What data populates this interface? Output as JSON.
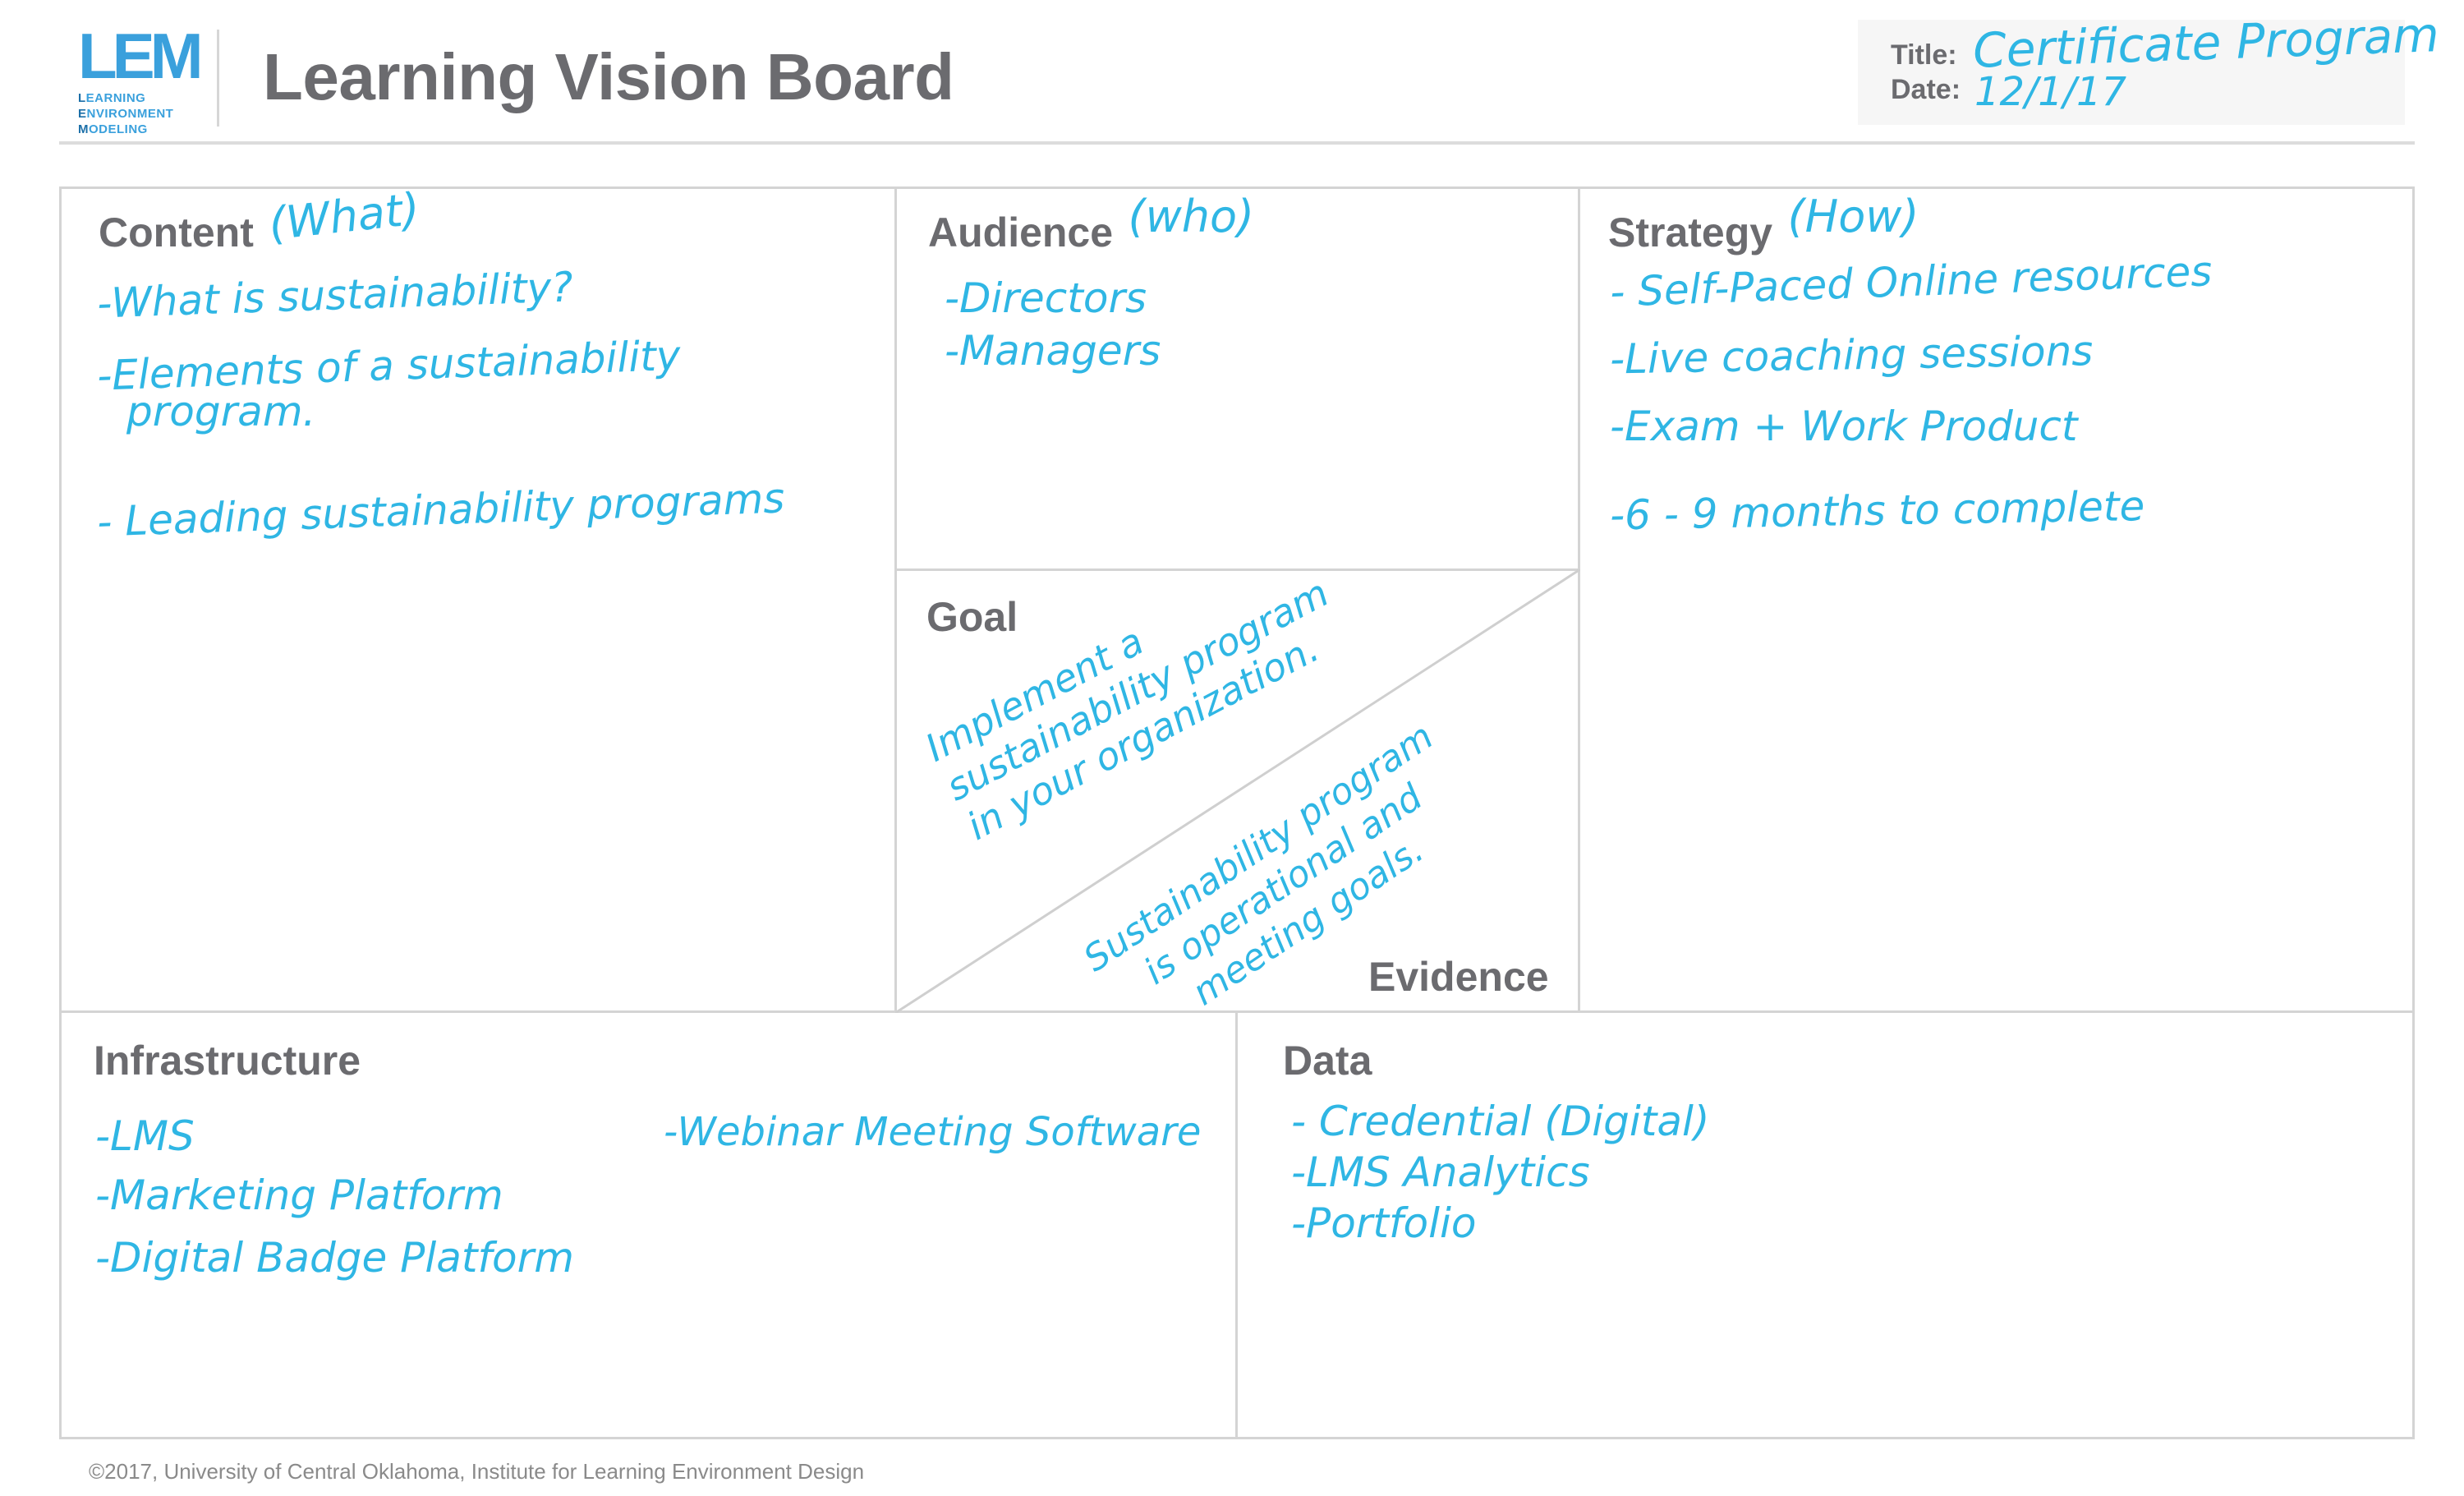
{
  "logo": {
    "mark": "LEM",
    "lines": [
      {
        "initial": "L",
        "rest": "EARNING"
      },
      {
        "initial": "E",
        "rest": "NVIRONMENT"
      },
      {
        "initial": "M",
        "rest": "ODELING"
      }
    ]
  },
  "header": {
    "title": "Learning Vision Board",
    "title_label": "Title:",
    "title_value": "Certificate Program",
    "date_label": "Date:",
    "date_value": "12/1/17"
  },
  "colors": {
    "handwriting": "#2fb6e4",
    "brand": "#3aa0dc",
    "heading": "#6b6b6f",
    "border": "#d4d4d4"
  },
  "panels": {
    "content": {
      "title": "Content",
      "aside": "(What)",
      "items": [
        "-What is sustainability?",
        "-Elements of a sustainability",
        "program.",
        "- Leading sustainability programs"
      ]
    },
    "audience": {
      "title": "Audience",
      "aside": "(who)",
      "items": [
        "-Directors",
        "-Managers"
      ]
    },
    "strategy": {
      "title": "Strategy",
      "aside": "(How)",
      "items": [
        "- Self-Paced Online resources",
        "-Live coaching sessions",
        "-Exam + Work Product",
        "-6 - 9 months to complete"
      ]
    },
    "goal": {
      "title": "Goal",
      "lines": [
        "Implement a",
        "sustainability program",
        "in your organization."
      ]
    },
    "evidence": {
      "title": "Evidence",
      "lines": [
        "Sustainability program",
        "is operational and",
        "meeting goals."
      ]
    },
    "infrastructure": {
      "title": "Infrastructure",
      "items": [
        "-LMS",
        "-Marketing Platform",
        "-Digital Badge Platform"
      ],
      "extra_item": "-Webinar Meeting Software"
    },
    "data": {
      "title": "Data",
      "items": [
        "- Credential (Digital)",
        "-LMS Analytics",
        "-Portfolio"
      ]
    }
  },
  "footer": {
    "copyright": "©2017, University of Central Oklahoma, Institute for Learning Environment Design"
  }
}
